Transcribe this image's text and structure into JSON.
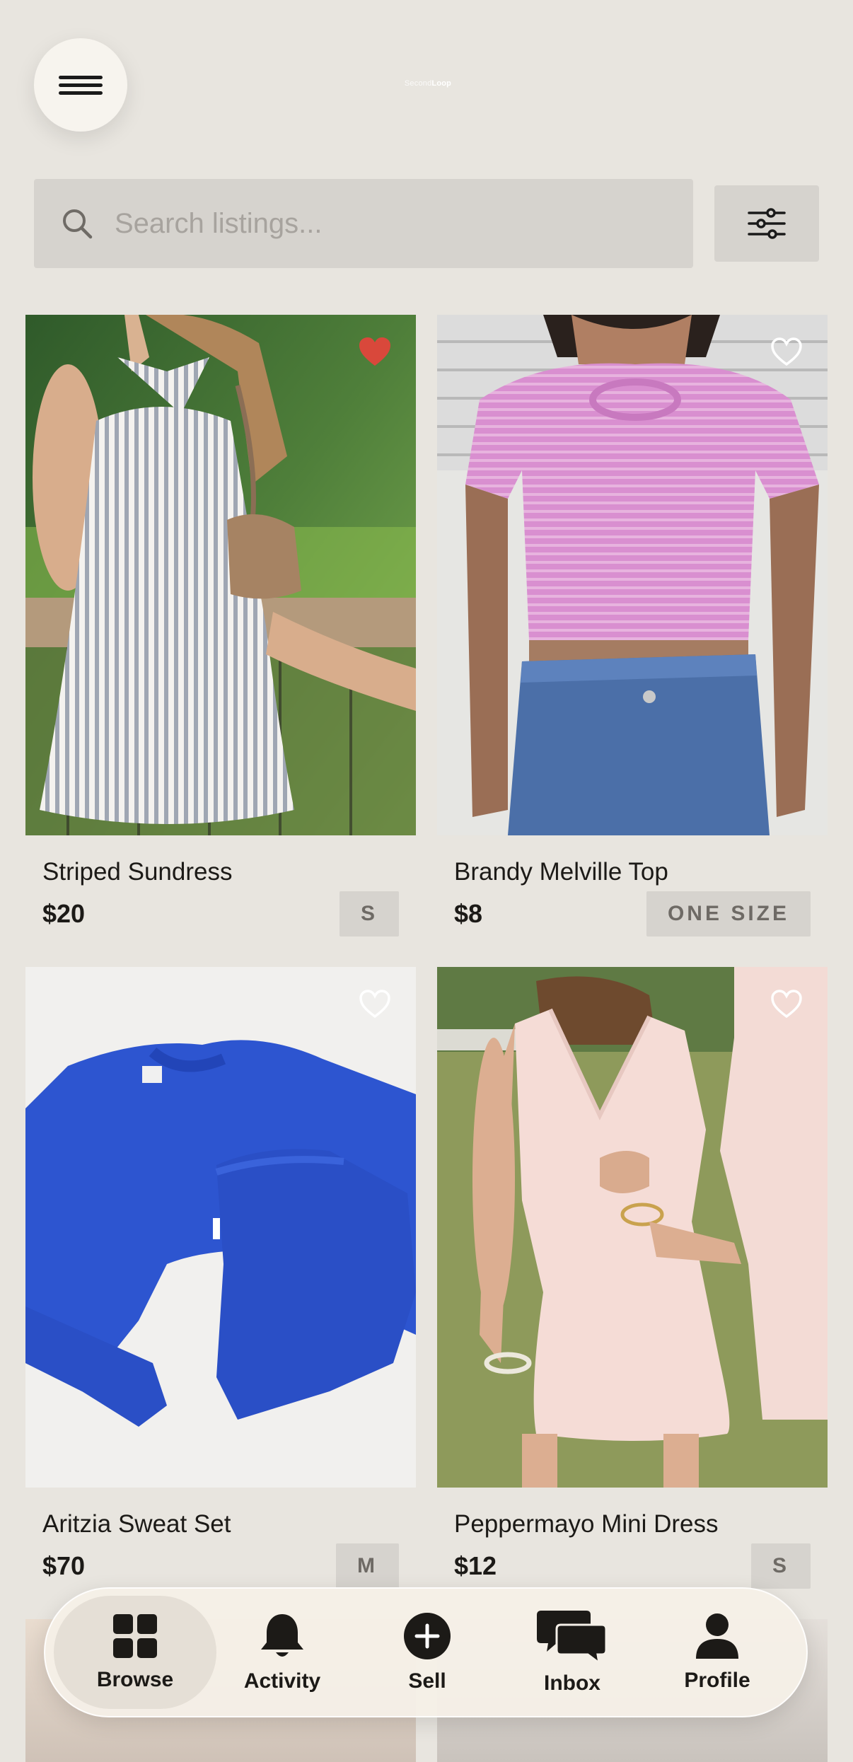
{
  "header": {
    "logo_part1": "Second",
    "logo_part2": "Loop",
    "menu_icon": "hamburger-menu-icon"
  },
  "search": {
    "placeholder": "Search listings...",
    "value": ""
  },
  "listings": [
    {
      "title": "Striped Sundress",
      "price": "$20",
      "size": "S",
      "favorited": true
    },
    {
      "title": "Brandy Melville Top",
      "price": "$8",
      "size": "ONE SIZE",
      "favorited": false
    },
    {
      "title": "Aritzia Sweat Set",
      "price": "$70",
      "size": "M",
      "favorited": false
    },
    {
      "title": "Peppermayo Mini Dress",
      "price": "$12",
      "size": "S",
      "favorited": false
    }
  ],
  "tabbar": {
    "items": [
      {
        "label": "Browse",
        "icon": "grid-icon",
        "active": true
      },
      {
        "label": "Activity",
        "icon": "bell-icon",
        "active": false
      },
      {
        "label": "Sell",
        "icon": "plus-circle-icon",
        "active": false
      },
      {
        "label": "Inbox",
        "icon": "chat-bubbles-icon",
        "active": false
      },
      {
        "label": "Profile",
        "icon": "person-icon",
        "active": false
      }
    ]
  },
  "colors": {
    "background": "#e8e5df",
    "favorite_heart": "#d9483b",
    "chip_bg": "#d6d3ce"
  }
}
